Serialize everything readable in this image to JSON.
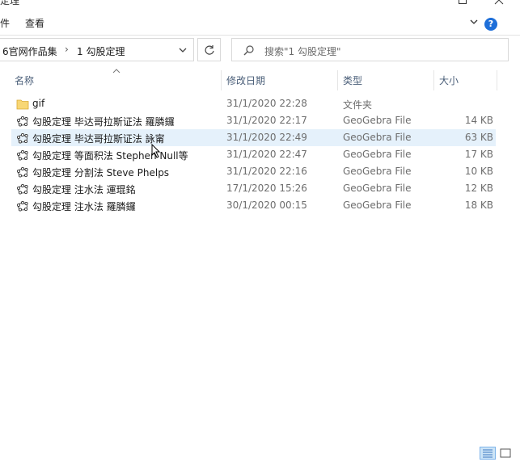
{
  "window": {
    "title": "定理"
  },
  "ribbon": {
    "file_label": "件",
    "view_label": "查看",
    "help_label": "?"
  },
  "address": {
    "crumbs": [
      "6官网作品集",
      "1 勾股定理"
    ],
    "separator": "›"
  },
  "search": {
    "placeholder": "搜索\"1 勾股定理\""
  },
  "columns": {
    "name": "名称",
    "date": "修改日期",
    "type": "类型",
    "size": "大小"
  },
  "files": [
    {
      "name": "gif",
      "date": "31/1/2020 22:28",
      "type": "文件夹",
      "size": "",
      "icon": "folder-icon"
    },
    {
      "name": "勾股定理 毕达哥拉斯证法 羅膦鑼",
      "date": "31/1/2020 22:17",
      "type": "GeoGebra File",
      "size": "14 KB",
      "icon": "geogebra-icon"
    },
    {
      "name": "勾股定理 毕达哥拉斯证法 詠甯",
      "date": "31/1/2020 22:49",
      "type": "GeoGebra File",
      "size": "63 KB",
      "icon": "geogebra-icon",
      "selected": true
    },
    {
      "name": "勾股定理 等面积法 Stephen Null等",
      "date": "31/1/2020 22:47",
      "type": "GeoGebra File",
      "size": "17 KB",
      "icon": "geogebra-icon"
    },
    {
      "name": "勾股定理 分割法 Steve Phelps",
      "date": "31/1/2020 22:16",
      "type": "GeoGebra File",
      "size": "10 KB",
      "icon": "geogebra-icon"
    },
    {
      "name": "勾股定理 注水法 運琨銘",
      "date": "17/1/2020 15:26",
      "type": "GeoGebra File",
      "size": "12 KB",
      "icon": "geogebra-icon"
    },
    {
      "name": "勾股定理 注水法 羅膦鑼",
      "date": "30/1/2020 00:15",
      "type": "GeoGebra File",
      "size": "18 KB",
      "icon": "geogebra-icon"
    }
  ],
  "colors": {
    "selected_row": "#e5f1fb",
    "header_text": "#4c607a",
    "folder": "#f8d775",
    "accent": "#1e6fd9"
  }
}
